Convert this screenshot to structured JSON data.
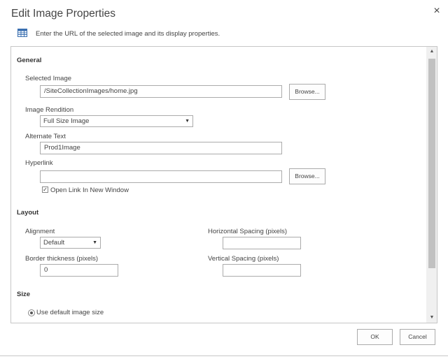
{
  "dialog": {
    "title": "Edit Image Properties",
    "close_label": "×",
    "intro_text": "Enter the URL of the selected image and its display properties."
  },
  "general": {
    "heading": "General",
    "selected_image": {
      "label": "Selected Image",
      "value": "/SiteCollectionImages/home.jpg",
      "browse_label": "Browse..."
    },
    "image_rendition": {
      "label": "Image Rendition",
      "selected": "Full Size Image"
    },
    "alternate_text": {
      "label": "Alternate Text",
      "value": "Prod1Image"
    },
    "hyperlink": {
      "label": "Hyperlink",
      "value": "",
      "browse_label": "Browse..."
    },
    "open_new_window": {
      "label": "Open Link In New Window",
      "checked": true
    }
  },
  "layout": {
    "heading": "Layout",
    "alignment": {
      "label": "Alignment",
      "selected": "Default"
    },
    "horizontal_spacing": {
      "label": "Horizontal Spacing (pixels)",
      "value": ""
    },
    "border_thickness": {
      "label": "Border thickness (pixels)",
      "value": "0"
    },
    "vertical_spacing": {
      "label": "Vertical Spacing (pixels)",
      "value": ""
    }
  },
  "size": {
    "heading": "Size",
    "default_size": {
      "label": "Use default image size",
      "selected": true
    }
  },
  "footer": {
    "ok_label": "OK",
    "cancel_label": "Cancel"
  },
  "icons": {
    "close": "close-icon",
    "intro": "table-icon",
    "scroll_up": "chevron-up-icon",
    "scroll_down": "chevron-down-icon"
  }
}
